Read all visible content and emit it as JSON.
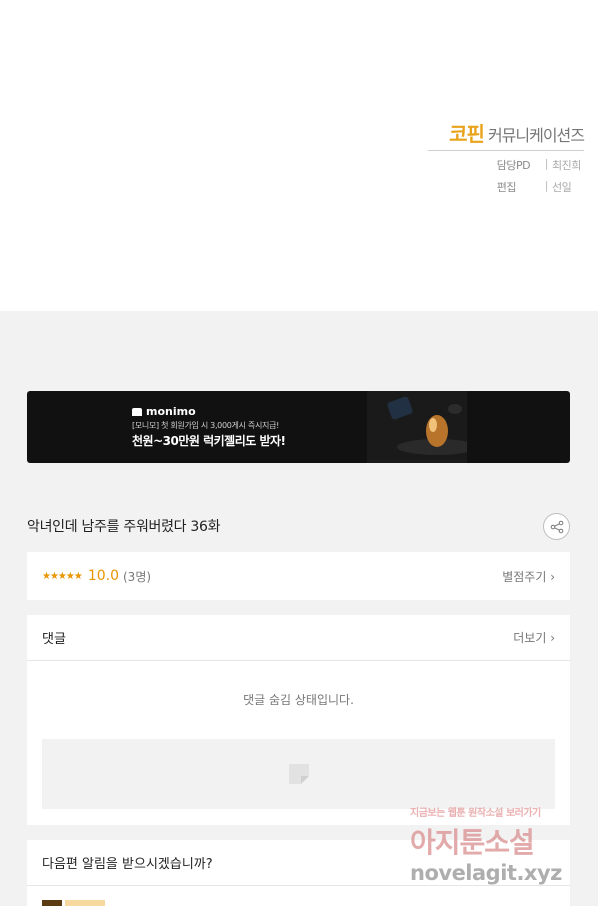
{
  "credits": {
    "brand_mark": "코핀",
    "brand_name": "커뮤니케이션즈",
    "rows": [
      {
        "role": "담당PD",
        "person": "최진희"
      },
      {
        "role": "편집",
        "person": "선일"
      }
    ]
  },
  "banner": {
    "logo_text": "monimo",
    "sub_text": "[모니모] 첫 회원가입 시 3,000게시 즉시지급!",
    "main_text": "천원~30만원 럭키젤리도 받자!"
  },
  "episode": {
    "title": "악녀인데 남주를 주워버렸다 36화"
  },
  "rating": {
    "stars": "★★★★★",
    "score": "10.0",
    "count": "(3명)",
    "rate_link": "별점주기 ›"
  },
  "comments": {
    "title": "댓글",
    "more": "더보기 ›",
    "hidden_message": "댓글 숨김 상태입니다."
  },
  "notify": {
    "title": "다음편 알림을 받으시겠습니까?"
  },
  "watermark": {
    "top": "지금보는 웹툰 원작소설 보러가기",
    "main": "아지툰소설",
    "url": "novelagit.xyz"
  },
  "colors": {
    "accent": "#e99500",
    "brand": "#e9a31b",
    "page_bg": "#f2f2f2"
  }
}
